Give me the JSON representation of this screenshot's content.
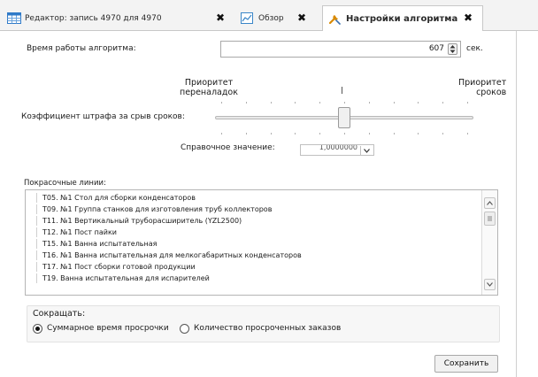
{
  "tabs": [
    {
      "label": "Редактор: запись 4970 для 4970",
      "icon": "grid-icon",
      "active": false
    },
    {
      "label": "Обзор",
      "icon": "chart-icon",
      "active": false
    },
    {
      "label": "Настройки алгоритма",
      "icon": "wrench-icon",
      "active": true
    }
  ],
  "tab_close_glyph": "✖",
  "form": {
    "runtime_label": "Время работы алгоритма:",
    "runtime_value": "607",
    "runtime_unit": "сек.",
    "priority_changeover": "Приоритет\nпереналадок",
    "priority_deadlines": "Приоритет\nсроков",
    "penalty_label": "Коэффициент штрафа за срыв сроков:",
    "slider_position": 0.5,
    "reference_label": "Справочное значение:",
    "reference_value": "1,0000000",
    "lines_label": "Покрасочные линии:",
    "lines": [
      "T05. №1 Стол для сборки конденсаторов",
      "T09. №1 Группа станков для изготовления труб коллекторов",
      "T11. №1 Вертикальный труборасширитель (YZL2500)",
      "T12. №1 Пост пайки",
      "T15. №1 Ванна испытательная",
      "T16. №1 Ванна испытательная для мелкогабаритных конденсаторов",
      "T17. №1 Пост сборки готовой продукции",
      "T19. Ванна испытательная для испарителей"
    ],
    "reduce_label": "Сокращать:",
    "reduce_options": [
      {
        "label": "Суммарное время просрочки",
        "selected": true
      },
      {
        "label": "Количество просроченных заказов",
        "selected": false
      }
    ],
    "save_label": "Сохранить"
  },
  "colors": {
    "wrench_icon": "#d98a00",
    "grid_icon": "#2f7ac8",
    "chart_icon": "#3a86c8"
  }
}
